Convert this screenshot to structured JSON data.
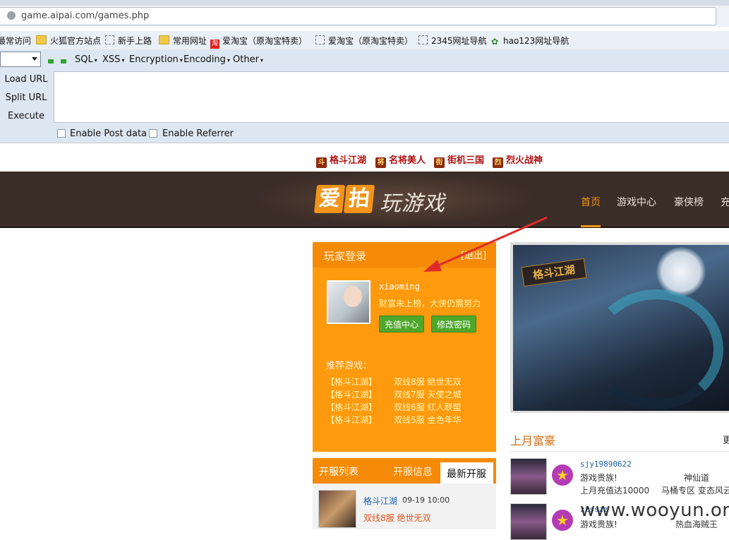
{
  "browser": {
    "url": "game.aipai.com/games.php"
  },
  "bookmarks": [
    {
      "label": "最常访问",
      "icon": "none"
    },
    {
      "label": "火狐官方站点",
      "icon": "folder-icon"
    },
    {
      "label": "新手上路",
      "icon": "page-icon"
    },
    {
      "label": "常用网址",
      "icon": "folder-icon"
    },
    {
      "label": "爱淘宝（原淘宝特卖）",
      "icon": "taobao-icon"
    },
    {
      "label": "爱淘宝（原淘宝特卖）",
      "icon": "page-icon"
    },
    {
      "label": "2345网址导航",
      "icon": "page-icon"
    },
    {
      "label": "hao123网址导航",
      "icon": "hao123-icon"
    }
  ],
  "hackbar": {
    "menus": [
      "SQL",
      "XSS",
      "Encryption",
      "Encoding",
      "Other"
    ],
    "actions": [
      "Load URL",
      "Split URL",
      "Execute"
    ],
    "checkboxes": [
      "Enable Post data",
      "Enable Referrer"
    ]
  },
  "game_links": [
    "格斗江湖",
    "名将美人",
    "街机三国",
    "烈火战神"
  ],
  "header": {
    "logo_ai": "爱",
    "logo_pai": "拍",
    "logo_play": "玩游戏",
    "nav": [
      "首页",
      "游戏中心",
      "豪侠榜",
      "充"
    ],
    "active_nav": "首页"
  },
  "login_panel": {
    "title": "玩家登录",
    "logout": "[退出]",
    "username": "xiaoming",
    "rich_message": "财富未上榜，大侠仍需努力",
    "recharge_button": "充值中心",
    "change_password_button": "修改密码",
    "recommended_title": "推荐游戏：",
    "recommended": [
      {
        "game": "【格斗江湖】",
        "server": "双线8服  绝世无双"
      },
      {
        "game": "【格斗江湖】",
        "server": "双线7服  天使之城"
      },
      {
        "game": "【格斗江湖】",
        "server": "双线6服  红人联盟"
      },
      {
        "game": "【格斗江湖】",
        "server": "双线5服  金色年华"
      }
    ]
  },
  "server_list": {
    "title": "开服列表",
    "tab_info": "开服信息",
    "tab_new": "最新开服",
    "entry": {
      "game": "格斗江湖",
      "time": "09-19  10:00",
      "server": "双线8服  绝世无双"
    }
  },
  "banner": {
    "logo": "格斗江湖"
  },
  "rich_list": {
    "title": "上月富豪",
    "more": "更",
    "entries": [
      {
        "name": "sjy19890622",
        "rank": "游戏贵族!",
        "server_name": "神仙道",
        "note": "上月充值达10000",
        "zone": "马桶专区  变态风云"
      },
      {
        "name": "zzsszz",
        "rank": "游戏贵族!",
        "server_name": "热血海贼王",
        "note": "",
        "zone": ""
      }
    ]
  },
  "watermark": "www.wooyun.org",
  "colors": {
    "accent_orange": "#ff9a0e",
    "header_brown": "#3b2d27",
    "button_green": "#4fa82c",
    "arrow_red": "#e02a2a"
  }
}
